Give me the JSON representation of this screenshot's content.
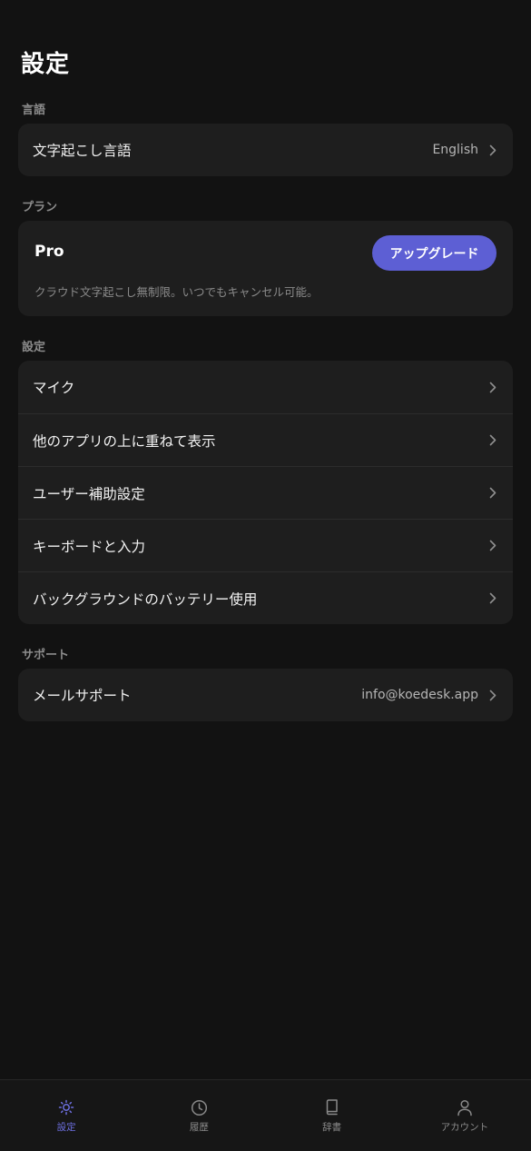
{
  "page": {
    "title": "設定"
  },
  "language_section": {
    "label": "言語",
    "transcription_language": {
      "label": "文字起こし言語",
      "value": "English"
    }
  },
  "plan_section": {
    "label": "プラン",
    "plan_name": "Pro",
    "upgrade_label": "アップグレード",
    "description": "クラウド文字起こし無制限。いつでもキャンセル可能。",
    "accent_color": "#5d5fd4"
  },
  "settings_section": {
    "label": "設定",
    "items": [
      {
        "label": "マイク"
      },
      {
        "label": "他のアプリの上に重ねて表示"
      },
      {
        "label": "ユーザー補助設定"
      },
      {
        "label": "キーボードと入力"
      },
      {
        "label": "バックグラウンドのバッテリー使用"
      }
    ]
  },
  "support_section": {
    "label": "サポート",
    "mail_support": {
      "label": "メールサポート",
      "value": "info@koedesk.app"
    }
  },
  "tabbar": {
    "tabs": [
      {
        "label": "設定",
        "icon": "gear-icon",
        "active": true
      },
      {
        "label": "履歴",
        "icon": "clock-icon",
        "active": false
      },
      {
        "label": "辞書",
        "icon": "book-icon",
        "active": false
      },
      {
        "label": "アカウント",
        "icon": "person-icon",
        "active": false
      }
    ]
  }
}
